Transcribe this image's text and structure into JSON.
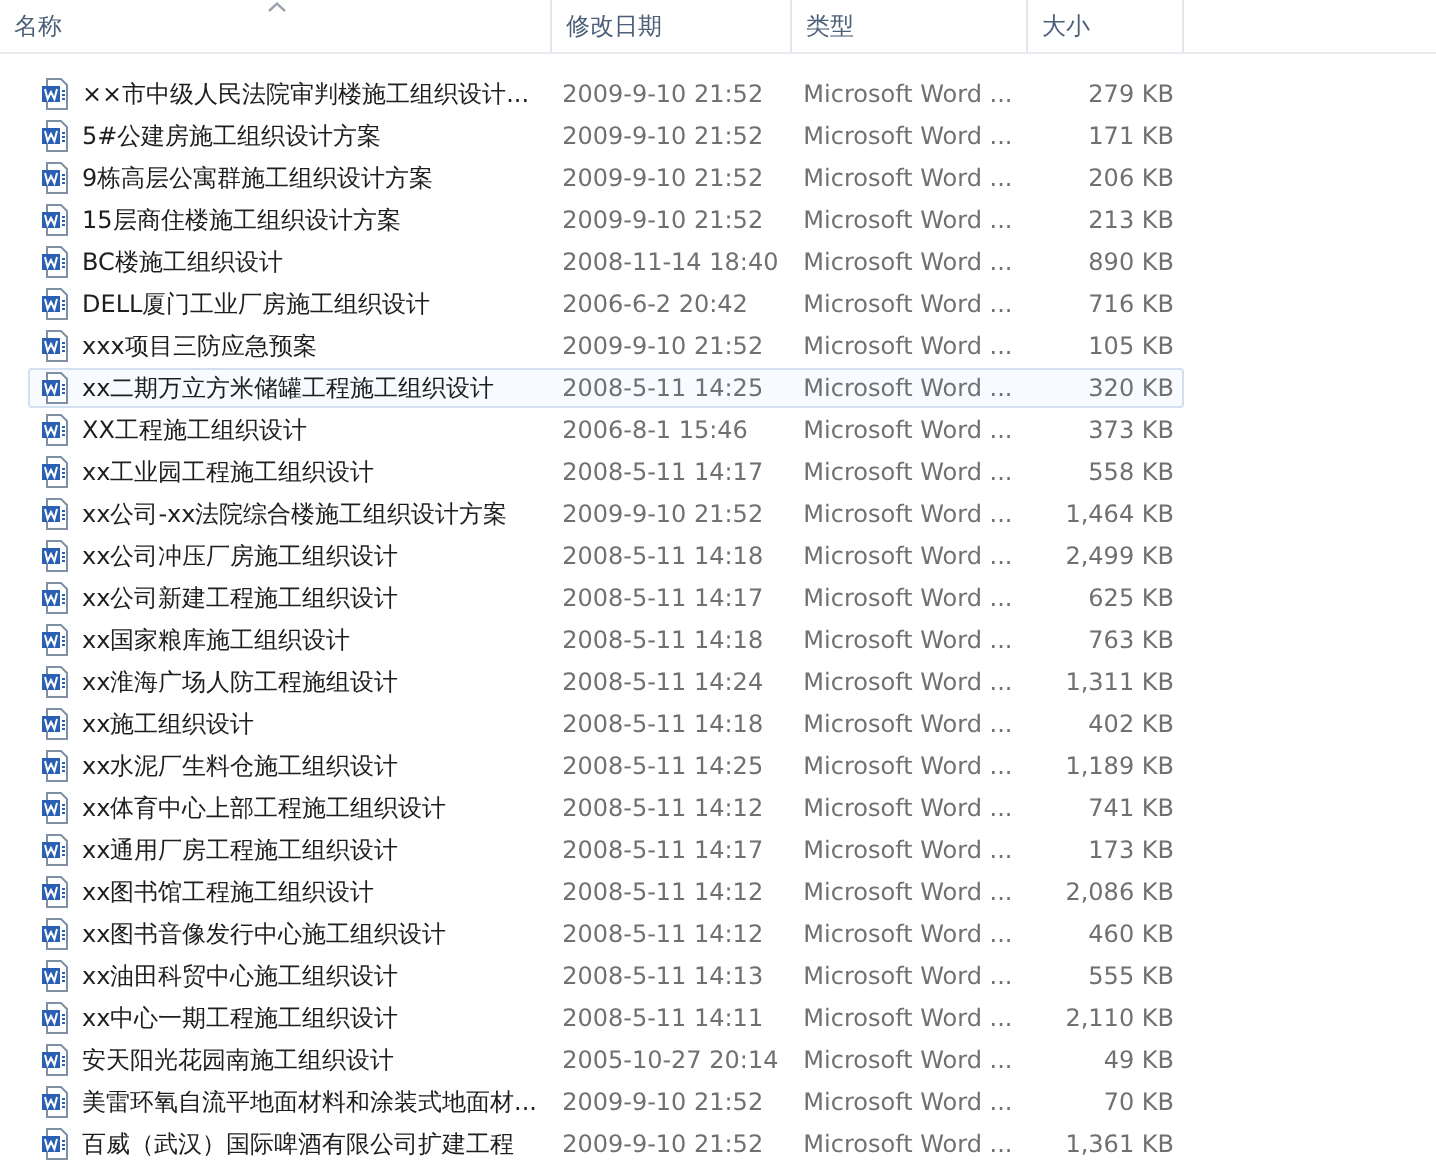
{
  "columns": [
    {
      "label": "名称",
      "sorted": true
    },
    {
      "label": "修改日期",
      "sorted": false
    },
    {
      "label": "类型",
      "sorted": false
    },
    {
      "label": "大小",
      "sorted": false
    }
  ],
  "rows": [
    {
      "name": "××市中级人民法院审判楼施工组织设计...",
      "date": "2009-9-10 21:52",
      "type": "Microsoft Word ...",
      "size": "279 KB",
      "selected": false
    },
    {
      "name": "5#公建房施工组织设计方案",
      "date": "2009-9-10 21:52",
      "type": "Microsoft Word ...",
      "size": "171 KB",
      "selected": false
    },
    {
      "name": "9栋高层公寓群施工组织设计方案",
      "date": "2009-9-10 21:52",
      "type": "Microsoft Word ...",
      "size": "206 KB",
      "selected": false
    },
    {
      "name": "15层商住楼施工组织设计方案",
      "date": "2009-9-10 21:52",
      "type": "Microsoft Word ...",
      "size": "213 KB",
      "selected": false
    },
    {
      "name": "BC楼施工组织设计",
      "date": "2008-11-14 18:40",
      "type": "Microsoft Word ...",
      "size": "890 KB",
      "selected": false
    },
    {
      "name": "DELL厦门工业厂房施工组织设计",
      "date": "2006-6-2 20:42",
      "type": "Microsoft Word ...",
      "size": "716 KB",
      "selected": false
    },
    {
      "name": "xxx项目三防应急预案",
      "date": "2009-9-10 21:52",
      "type": "Microsoft Word ...",
      "size": "105 KB",
      "selected": false
    },
    {
      "name": "xx二期万立方米储罐工程施工组织设计",
      "date": "2008-5-11 14:25",
      "type": "Microsoft Word ...",
      "size": "320 KB",
      "selected": true
    },
    {
      "name": "XX工程施工组织设计",
      "date": "2006-8-1 15:46",
      "type": "Microsoft Word ...",
      "size": "373 KB",
      "selected": false
    },
    {
      "name": "xx工业园工程施工组织设计",
      "date": "2008-5-11 14:17",
      "type": "Microsoft Word ...",
      "size": "558 KB",
      "selected": false
    },
    {
      "name": "xx公司-xx法院综合楼施工组织设计方案",
      "date": "2009-9-10 21:52",
      "type": "Microsoft Word ...",
      "size": "1,464 KB",
      "selected": false
    },
    {
      "name": "xx公司冲压厂房施工组织设计",
      "date": "2008-5-11 14:18",
      "type": "Microsoft Word ...",
      "size": "2,499 KB",
      "selected": false
    },
    {
      "name": "xx公司新建工程施工组织设计",
      "date": "2008-5-11 14:17",
      "type": "Microsoft Word ...",
      "size": "625 KB",
      "selected": false
    },
    {
      "name": "xx国家粮库施工组织设计",
      "date": "2008-5-11 14:18",
      "type": "Microsoft Word ...",
      "size": "763 KB",
      "selected": false
    },
    {
      "name": "xx淮海广场人防工程施组设计",
      "date": "2008-5-11 14:24",
      "type": "Microsoft Word ...",
      "size": "1,311 KB",
      "selected": false
    },
    {
      "name": "xx施工组织设计",
      "date": "2008-5-11 14:18",
      "type": "Microsoft Word ...",
      "size": "402 KB",
      "selected": false
    },
    {
      "name": "xx水泥厂生料仓施工组织设计",
      "date": "2008-5-11 14:25",
      "type": "Microsoft Word ...",
      "size": "1,189 KB",
      "selected": false
    },
    {
      "name": "xx体育中心上部工程施工组织设计",
      "date": "2008-5-11 14:12",
      "type": "Microsoft Word ...",
      "size": "741 KB",
      "selected": false
    },
    {
      "name": "xx通用厂房工程施工组织设计",
      "date": "2008-5-11 14:17",
      "type": "Microsoft Word ...",
      "size": "173 KB",
      "selected": false
    },
    {
      "name": "xx图书馆工程施工组织设计",
      "date": "2008-5-11 14:12",
      "type": "Microsoft Word ...",
      "size": "2,086 KB",
      "selected": false
    },
    {
      "name": "xx图书音像发行中心施工组织设计",
      "date": "2008-5-11 14:12",
      "type": "Microsoft Word ...",
      "size": "460 KB",
      "selected": false
    },
    {
      "name": "xx油田科贸中心施工组织设计",
      "date": "2008-5-11 14:13",
      "type": "Microsoft Word ...",
      "size": "555 KB",
      "selected": false
    },
    {
      "name": "xx中心一期工程施工组织设计",
      "date": "2008-5-11 14:11",
      "type": "Microsoft Word ...",
      "size": "2,110 KB",
      "selected": false
    },
    {
      "name": "安天阳光花园南施工组织设计",
      "date": "2005-10-27 20:14",
      "type": "Microsoft Word ...",
      "size": "49 KB",
      "selected": false
    },
    {
      "name": "美雷环氧自流平地面材料和涂装式地面材...",
      "date": "2009-9-10 21:52",
      "type": "Microsoft Word ...",
      "size": "70 KB",
      "selected": false
    },
    {
      "name": "百威（武汉）国际啤酒有限公司扩建工程",
      "date": "2009-9-10 21:52",
      "type": "Microsoft Word ...",
      "size": "1,361 KB",
      "selected": false
    }
  ]
}
